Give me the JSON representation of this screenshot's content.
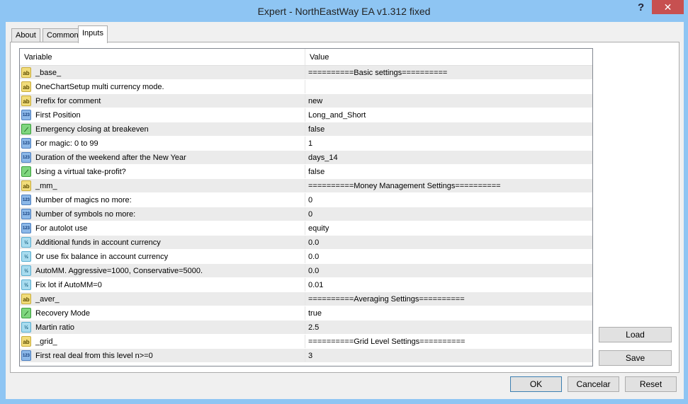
{
  "window": {
    "title": "Expert - NorthEastWay EA v1.312 fixed",
    "help": "?",
    "close": "✕"
  },
  "tabs": [
    "About",
    "Common",
    "Inputs"
  ],
  "table": {
    "headers": [
      "Variable",
      "Value"
    ],
    "rows": [
      {
        "type": "string",
        "icon": "ab",
        "variable": "_base_",
        "value": "==========Basic settings=========="
      },
      {
        "type": "string",
        "icon": "ab",
        "variable": "OneChartSetup multi currency mode.",
        "value": ""
      },
      {
        "type": "string",
        "icon": "ab",
        "variable": "Prefix for comment",
        "value": "new"
      },
      {
        "type": "int",
        "icon": "123",
        "variable": "First Position",
        "value": "Long_and_Short"
      },
      {
        "type": "bool",
        "icon": "⟋",
        "variable": "Emergency closing at breakeven",
        "value": "false"
      },
      {
        "type": "int",
        "icon": "123",
        "variable": "For magic: 0 to 99",
        "value": "1"
      },
      {
        "type": "int",
        "icon": "123",
        "variable": "Duration of the weekend after the New Year",
        "value": "days_14"
      },
      {
        "type": "bool",
        "icon": "⟋",
        "variable": "Using a virtual take-profit?",
        "value": "false"
      },
      {
        "type": "string",
        "icon": "ab",
        "variable": "_mm_",
        "value": "==========Money Management Settings=========="
      },
      {
        "type": "int",
        "icon": "123",
        "variable": "Number of magics no more:",
        "value": "0"
      },
      {
        "type": "int",
        "icon": "123",
        "variable": "Number of symbols no more:",
        "value": "0"
      },
      {
        "type": "int",
        "icon": "123",
        "variable": "For autolot use",
        "value": "equity"
      },
      {
        "type": "double",
        "icon": "½",
        "variable": "Additional funds in account currency",
        "value": "0.0"
      },
      {
        "type": "double",
        "icon": "½",
        "variable": "Or use fix balance in account currency",
        "value": "0.0"
      },
      {
        "type": "double",
        "icon": "½",
        "variable": "AutoMM. Aggressive=1000, Conservative=5000.",
        "value": "0.0"
      },
      {
        "type": "double",
        "icon": "½",
        "variable": "Fix lot if AutoMM=0",
        "value": "0.01"
      },
      {
        "type": "string",
        "icon": "ab",
        "variable": "_aver_",
        "value": "==========Averaging Settings=========="
      },
      {
        "type": "bool",
        "icon": "⟋",
        "variable": "Recovery Mode",
        "value": "true"
      },
      {
        "type": "double",
        "icon": "½",
        "variable": "Martin ratio",
        "value": "2.5"
      },
      {
        "type": "string",
        "icon": "ab",
        "variable": "_grid_",
        "value": "==========Grid Level Settings=========="
      },
      {
        "type": "int",
        "icon": "123",
        "variable": "First real deal from this level n>=0",
        "value": "3"
      }
    ]
  },
  "buttons": {
    "load": "Load",
    "save": "Save",
    "ok": "OK",
    "cancel": "Cancelar",
    "reset": "Reset"
  }
}
